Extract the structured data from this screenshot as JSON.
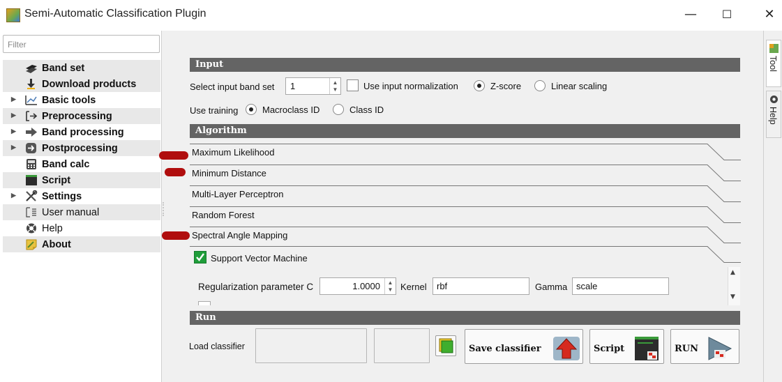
{
  "window": {
    "title": "Semi-Automatic Classification Plugin",
    "minimize_glyph": "—",
    "maximize_glyph": "☐",
    "close_glyph": "✕"
  },
  "sidebar": {
    "filter_placeholder": "Filter",
    "items": [
      {
        "label": "Band set",
        "icon": "band-set-icon",
        "expandable": false,
        "bold": true
      },
      {
        "label": "Download products",
        "icon": "download-icon",
        "expandable": false,
        "bold": true
      },
      {
        "label": "Basic tools",
        "icon": "basic-tools-icon",
        "expandable": true,
        "bold": true
      },
      {
        "label": "Preprocessing",
        "icon": "preprocessing-icon",
        "expandable": true,
        "bold": true
      },
      {
        "label": "Band processing",
        "icon": "band-processing-icon",
        "expandable": true,
        "bold": true
      },
      {
        "label": "Postprocessing",
        "icon": "postprocessing-icon",
        "expandable": true,
        "bold": true
      },
      {
        "label": "Band calc",
        "icon": "calculator-icon",
        "expandable": false,
        "bold": true
      },
      {
        "label": "Script",
        "icon": "script-icon",
        "expandable": false,
        "bold": true
      },
      {
        "label": "Settings",
        "icon": "settings-icon",
        "expandable": true,
        "bold": true
      },
      {
        "label": "User manual",
        "icon": "manual-icon",
        "expandable": false,
        "bold": false
      },
      {
        "label": "Help",
        "icon": "help-icon",
        "expandable": false,
        "bold": false
      },
      {
        "label": "About",
        "icon": "about-icon",
        "expandable": false,
        "bold": true
      }
    ]
  },
  "input": {
    "section_title": "Input",
    "band_set_label": "Select input band set",
    "band_set_value": "1",
    "normalization_label": "Use input normalization",
    "normalization_checked": false,
    "zscore_label": "Z-score",
    "zscore_selected": true,
    "linear_label": "Linear scaling",
    "linear_selected": false,
    "training_label": "Use training",
    "macroclass_label": "Macroclass ID",
    "macroclass_selected": true,
    "classid_label": "Class ID",
    "classid_selected": false
  },
  "algorithm": {
    "section_title": "Algorithm",
    "options": [
      {
        "label": "Maximum Likelihood",
        "marked": true
      },
      {
        "label": "Minimum Distance",
        "marked": true
      },
      {
        "label": "Multi-Layer Perceptron",
        "marked": false
      },
      {
        "label": "Random Forest",
        "marked": false
      },
      {
        "label": "Spectral Angle Mapping",
        "marked": true
      }
    ],
    "svm": {
      "label": "Support Vector Machine",
      "checked": true,
      "reg_label": "Regularization parameter C",
      "reg_value": "1.0000",
      "kernel_label": "Kernel",
      "kernel_value": "rbf",
      "gamma_label": "Gamma",
      "gamma_value": "scale"
    }
  },
  "run": {
    "section_title": "Run",
    "load_label": "Load classifier",
    "save_label": "Save classifier",
    "script_label": "Script",
    "run_label": "RUN"
  },
  "dock_tabs": {
    "tool": "Tool",
    "help": "Help"
  },
  "colors": {
    "section_bar": "#646464",
    "marker": "#b00e0e",
    "save_arrow": "#d62a1f",
    "checkbox_green": "#1f9d3a"
  }
}
